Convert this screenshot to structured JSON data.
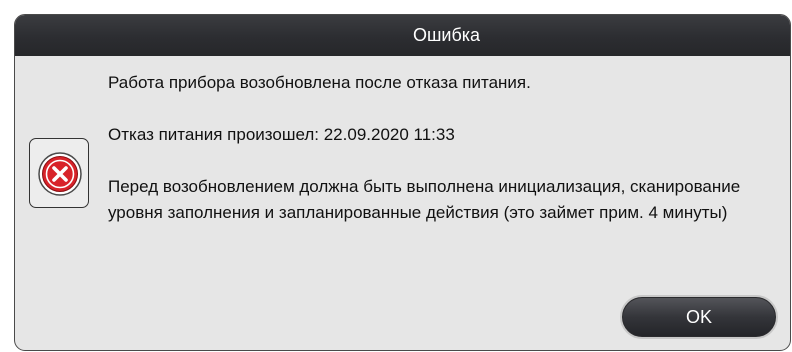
{
  "dialog": {
    "title": "Ошибка",
    "icon": "error-x-icon",
    "messages": [
      "Работа прибора возобновлена после отказа питания.",
      "Отказ питания произошел: 22.09.2020 11:33",
      "Перед возобновлением должна быть выполнена инициализация, сканирование уровня заполнения и запланированные действия (это займет прим. 4 минуты)"
    ],
    "ok_label": "OK"
  },
  "colors": {
    "title_bar": "#2c2d31",
    "dialog_body": "#e6e6e6",
    "error_red": "#d8232a",
    "button": "#34353a"
  }
}
